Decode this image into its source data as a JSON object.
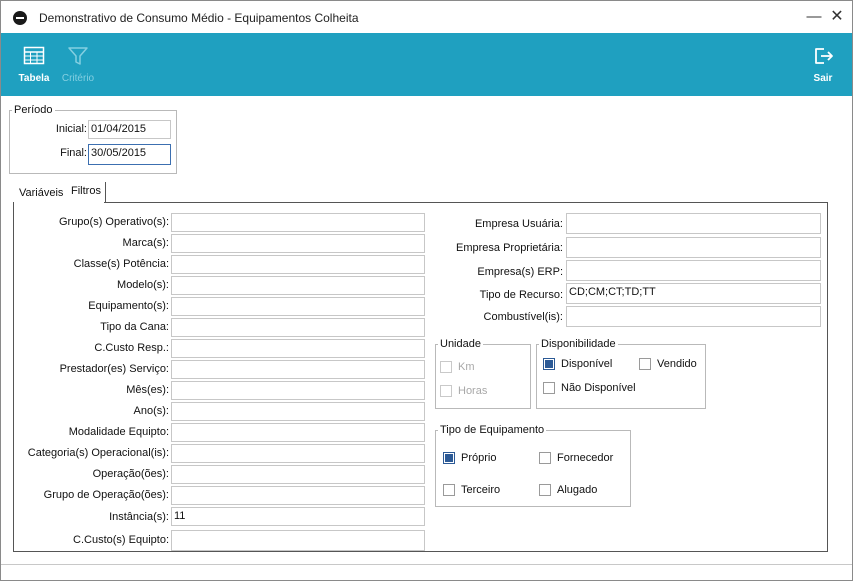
{
  "window": {
    "title": "Demonstrativo de Consumo Médio - Equipamentos Colheita"
  },
  "toolbar": {
    "tabela_label": "Tabela",
    "criterio_label": "Critério",
    "sair_label": "Sair"
  },
  "periodo": {
    "legend": "Período",
    "inicial_label": "Inicial:",
    "inicial_value": "01/04/2015",
    "final_label": "Final:",
    "final_value": "30/05/2015"
  },
  "tabs": {
    "variaveis": "Variáveis",
    "filtros": "Filtros"
  },
  "filters_left": [
    {
      "label": "Grupo(s) Operativo(s):",
      "value": ""
    },
    {
      "label": "Marca(s):",
      "value": ""
    },
    {
      "label": "Classe(s) Potência:",
      "value": ""
    },
    {
      "label": "Modelo(s):",
      "value": ""
    },
    {
      "label": "Equipamento(s):",
      "value": ""
    },
    {
      "label": "Tipo da Cana:",
      "value": ""
    },
    {
      "label": "C.Custo Resp.:",
      "value": ""
    },
    {
      "label": "Prestador(es) Serviço:",
      "value": ""
    },
    {
      "label": "Mês(es):",
      "value": ""
    },
    {
      "label": "Ano(s):",
      "value": ""
    },
    {
      "label": "Modalidade Equipto:",
      "value": ""
    },
    {
      "label": "Categoria(s) Operacional(is):",
      "value": ""
    },
    {
      "label": "Operação(ões):",
      "value": ""
    },
    {
      "label": "Grupo de Operação(ões):",
      "value": ""
    },
    {
      "label": "Instância(s):",
      "value": "11"
    },
    {
      "label": "C.Custo(s) Equipto:",
      "value": ""
    }
  ],
  "filters_right": [
    {
      "label": "Empresa Usuária:",
      "value": ""
    },
    {
      "label": "Empresa Proprietária:",
      "value": ""
    },
    {
      "label": "Empresa(s) ERP:",
      "value": ""
    },
    {
      "label": "Tipo de Recurso:",
      "value": "CD;CM;CT;TD;TT"
    },
    {
      "label": "Combustível(is):",
      "value": ""
    }
  ],
  "unidade": {
    "legend": "Unidade",
    "km_label": "Km",
    "horas_label": "Horas"
  },
  "disponibilidade": {
    "legend": "Disponibilidade",
    "disponivel_label": "Disponível",
    "vendido_label": "Vendido",
    "nao_disponivel_label": "Não Disponível"
  },
  "tipo_equipamento": {
    "legend": "Tipo de Equipamento",
    "proprio_label": "Próprio",
    "fornecedor_label": "Fornecedor",
    "terceiro_label": "Terceiro",
    "alugado_label": "Alugado"
  },
  "colors": {
    "toolbar": "#1fa0c0",
    "checked": "#2c5a96"
  },
  "icons": {
    "app": "app-logo-icon",
    "tabela": "table-grid-icon",
    "criterio": "filter-funnel-icon",
    "sair": "exit-door-icon"
  }
}
